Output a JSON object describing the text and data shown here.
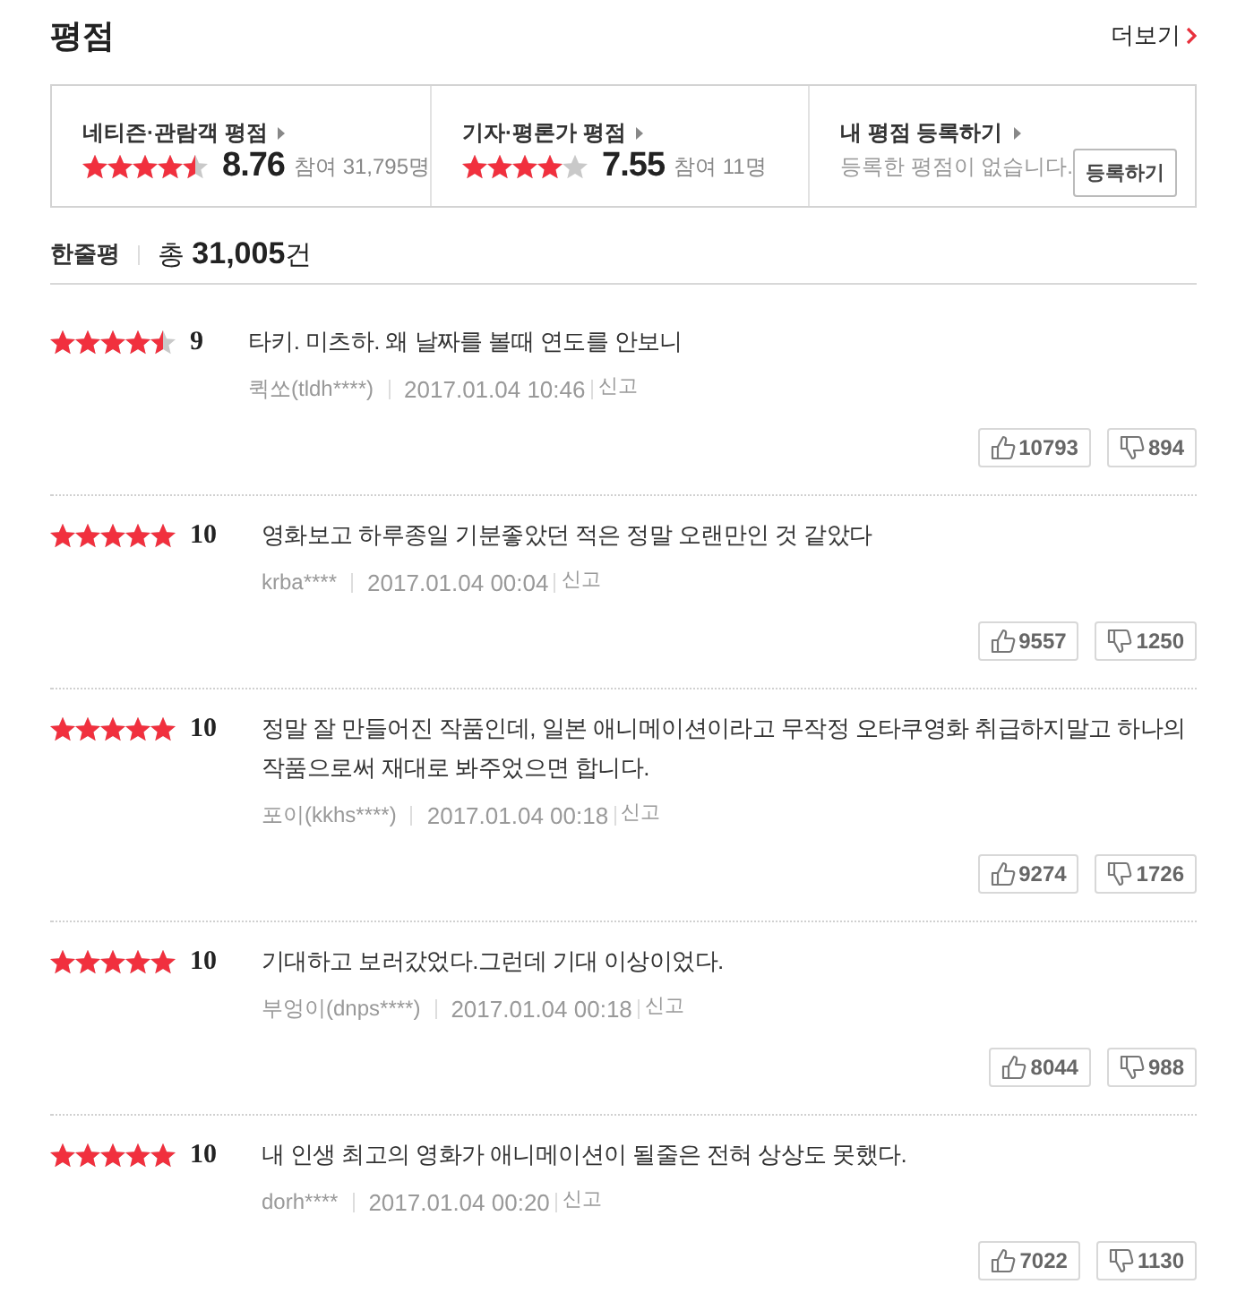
{
  "section": {
    "title": "평점",
    "more_link": "더보기"
  },
  "summary": [
    {
      "kind": "rating",
      "label": "네티즌·관람객 평점",
      "stars": 4.5,
      "score": "8.76",
      "participants": "참여 31,795명"
    },
    {
      "kind": "rating",
      "label": "기자·평론가 평점",
      "stars": 4,
      "score": "7.55",
      "participants": "참여 11명"
    },
    {
      "kind": "register",
      "label": "내 평점 등록하기",
      "message": "등록한 평점이 없습니다.",
      "button": "등록하기"
    }
  ],
  "reviews_header": {
    "title": "한줄평",
    "count": "총 **31,005**건"
  },
  "reviews": [
    {
      "stars": 4.5,
      "score": "9",
      "text": "타키. 미츠하. 왜 날짜를 볼때 연도를 안보니",
      "author": "퀵쏘(tldh****)",
      "date": "2017.01.04 10:46",
      "report": "신고",
      "likes": "10793",
      "dislikes": "894"
    },
    {
      "stars": 5,
      "score": "10",
      "text": "영화보고 하루종일 기분좋았던 적은 정말 오랜만인 것 같았다",
      "author": "krba****",
      "date": "2017.01.04 00:04",
      "report": "신고",
      "likes": "9557",
      "dislikes": "1250"
    },
    {
      "stars": 5,
      "score": "10",
      "text": "정말 잘 만들어진 작품인데, 일본 애니메이션이라고 무작정 오타쿠영화 취급하지말고 하나의 작품으로써 재대로 봐주었으면 합니다.",
      "author": "포이(kkhs****)",
      "date": "2017.01.04 00:18",
      "report": "신고",
      "likes": "9274",
      "dislikes": "1726"
    },
    {
      "stars": 5,
      "score": "10",
      "text": "기대하고 보러갔었다.그런데 기대 이상이었다.",
      "author": "부엉이(dnps****)",
      "date": "2017.01.04 00:18",
      "report": "신고",
      "likes": "8044",
      "dislikes": "988"
    },
    {
      "stars": 5,
      "score": "10",
      "text": "내 인생 최고의 영화가 애니메이션이 될줄은 전혀 상상도 못했다.",
      "author": "dorh****",
      "date": "2017.01.04 00:20",
      "report": "신고",
      "likes": "7022",
      "dislikes": "1130"
    }
  ]
}
